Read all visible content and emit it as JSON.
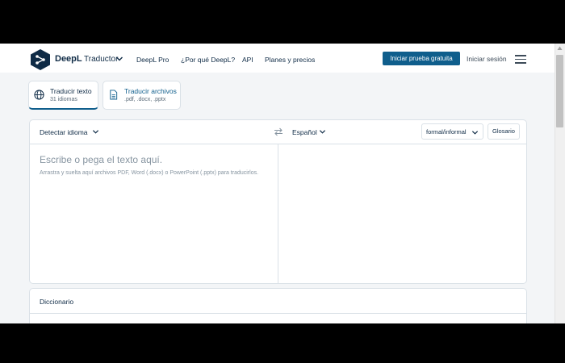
{
  "header": {
    "brand": "DeepL",
    "brand_sub": "Traductor",
    "nav": [
      "DeepL Pro",
      "¿Por qué DeepL?",
      "API",
      "Planes y precios"
    ],
    "cta": "Iniciar prueba gratuita",
    "login": "Iniciar sesión"
  },
  "tabs": [
    {
      "label": "Traducir texto",
      "sub": "31 idiomas",
      "icon": "globe-icon"
    },
    {
      "label": "Traducir archivos",
      "sub": ".pdf, .docx, .pptx",
      "icon": "document-icon"
    }
  ],
  "translator": {
    "source_language": "Detectar idioma",
    "target_language": "Español",
    "formality": "formal/informal",
    "glossary": "Glosario",
    "placeholder": "Escribe o pega el texto aquí.",
    "hint": "Arrastra y suelta aquí archivos PDF, Word (.docx) o PowerPoint (.pptx) para traducirlos."
  },
  "dictionary": {
    "title": "Diccionario"
  },
  "colors": {
    "brand": "#0f2b46",
    "accent": "#0f5e8c",
    "background": "#f3f5f7"
  }
}
